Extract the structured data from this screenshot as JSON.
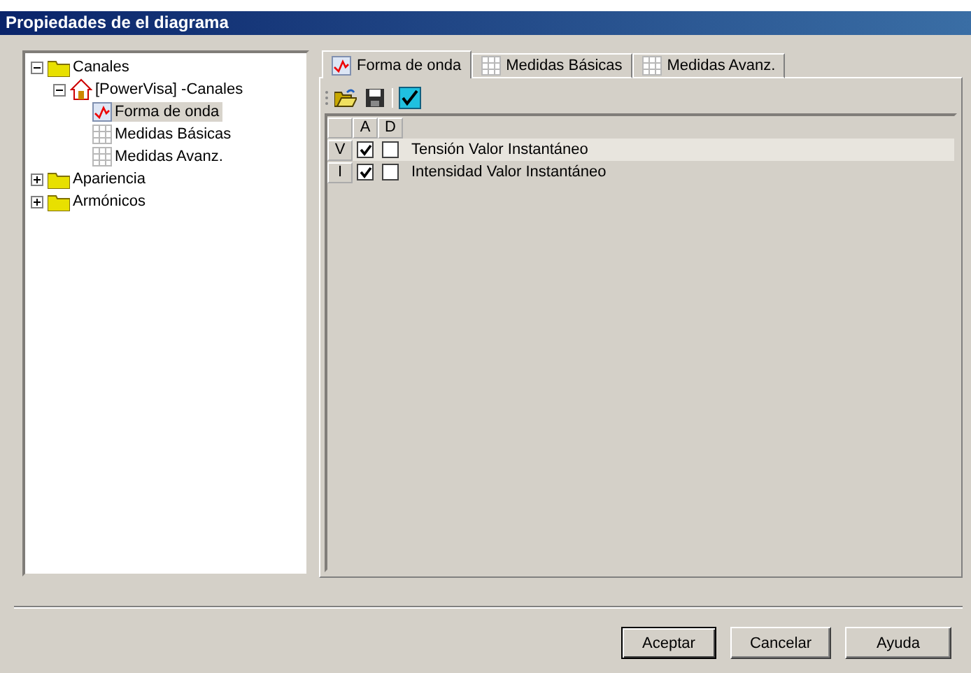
{
  "window": {
    "title": "Propiedades de el diagrama"
  },
  "tree": [
    {
      "label": "Canales",
      "kind": "folder",
      "expanded": true,
      "selected": false,
      "children": [
        {
          "label": "[PowerVisa] -Canales",
          "kind": "home",
          "expanded": true,
          "selected": false,
          "children": [
            {
              "label": "Forma de onda",
              "kind": "wave",
              "selected": true
            },
            {
              "label": "Medidas Básicas",
              "kind": "grid",
              "selected": false
            },
            {
              "label": "Medidas Avanz.",
              "kind": "grid",
              "selected": false
            }
          ]
        }
      ]
    },
    {
      "label": "Apariencia",
      "kind": "folder",
      "expanded": false,
      "selected": false
    },
    {
      "label": "Armónicos",
      "kind": "folder",
      "expanded": false,
      "selected": false
    }
  ],
  "tabs": [
    {
      "label": "Forma de onda",
      "kind": "wave",
      "selected": true
    },
    {
      "label": "Medidas Básicas",
      "kind": "grid",
      "selected": false
    },
    {
      "label": "Medidas Avanz.",
      "kind": "grid",
      "selected": false
    }
  ],
  "grid": {
    "columns": [
      "A",
      "D"
    ],
    "rows": [
      {
        "header": "V",
        "a": true,
        "d": false,
        "label": "Tensión Valor Instantáneo",
        "selected": true
      },
      {
        "header": "I",
        "a": true,
        "d": false,
        "label": "Intensidad Valor Instantáneo",
        "selected": false
      }
    ]
  },
  "buttons": [
    {
      "label": "Aceptar",
      "default": true
    },
    {
      "label": "Cancelar",
      "default": false
    },
    {
      "label": "Ayuda",
      "default": false
    }
  ]
}
